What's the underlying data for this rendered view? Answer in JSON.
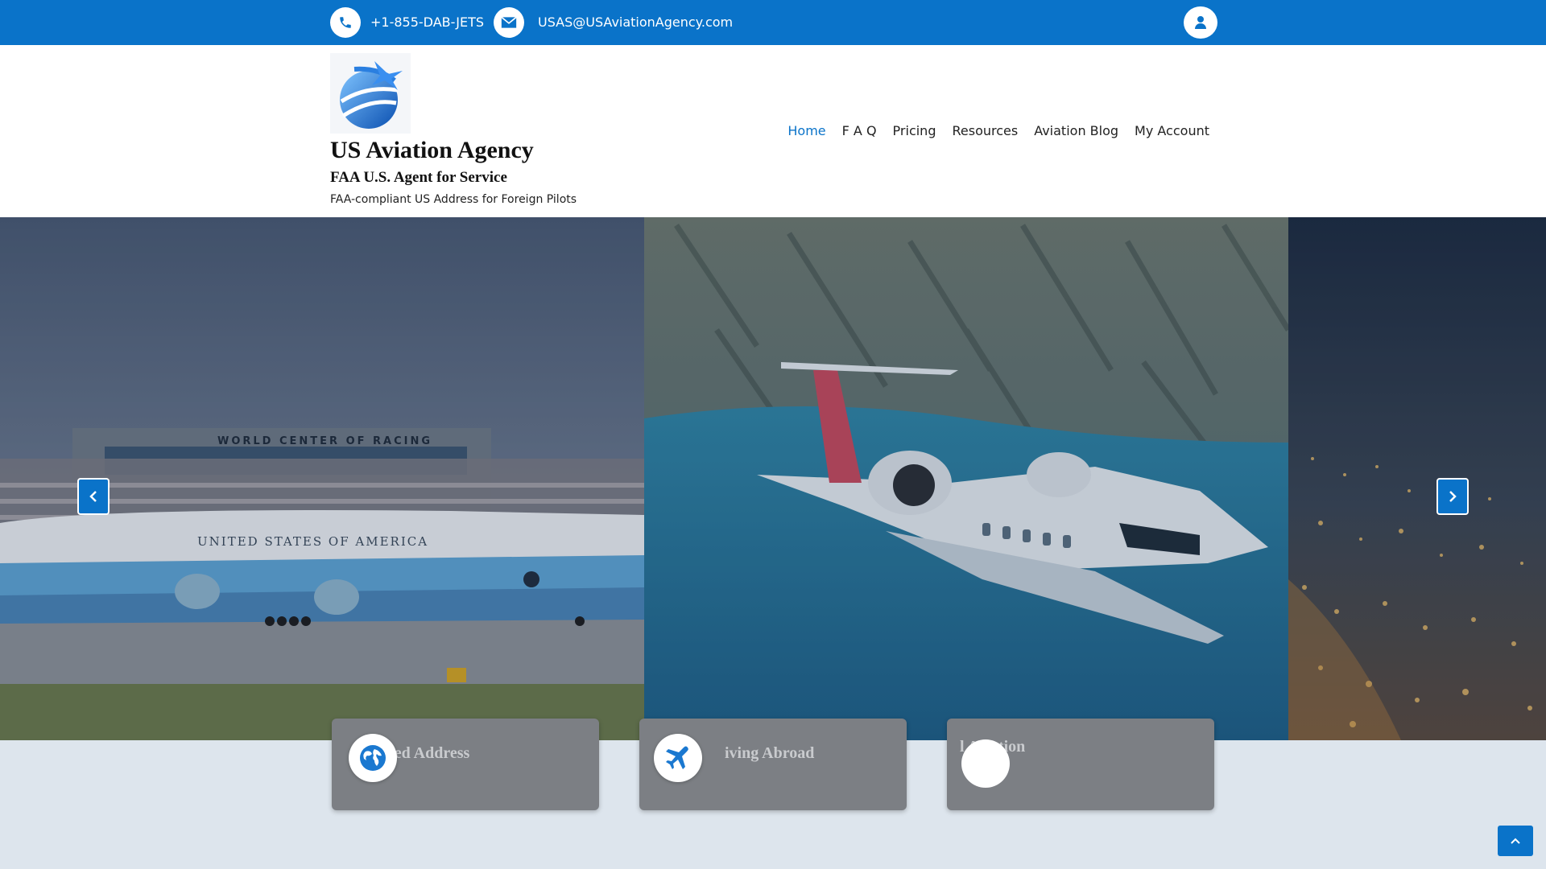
{
  "topbar": {
    "phone": "+1-855-DAB-JETS",
    "email": "USAS@USAviationAgency.com",
    "icons": [
      "phone-icon",
      "envelope-icon",
      "user-icon"
    ]
  },
  "header": {
    "site_title": "US Aviation Agency",
    "subtitle": "FAA U.S. Agent for Service",
    "tagline": "FAA-compliant US Address for Foreign Pilots",
    "logo": "globe-plane-logo"
  },
  "nav": {
    "items": [
      {
        "label": "Home",
        "active": true
      },
      {
        "label": "F A Q",
        "active": false
      },
      {
        "label": "Pricing",
        "active": false
      },
      {
        "label": "Resources",
        "active": false
      },
      {
        "label": "Aviation Blog",
        "active": false
      },
      {
        "label": "My Account",
        "active": false
      }
    ]
  },
  "hero": {
    "slide1_text": "WORLD CENTER OF RACING",
    "slide1_plane_text": "UNITED STATES OF AMERICA",
    "prev_icon": "chevron-left-icon",
    "next_icon": "chevron-right-icon"
  },
  "cards": [
    {
      "title": "US-Based Address",
      "visible_title": "ased Address",
      "icon": "globe-icon"
    },
    {
      "title": "Living Abroad",
      "visible_title": "iving Abroad",
      "icon": "airplane-icon"
    },
    {
      "title": "Aviation",
      "visible_title": "l Aviation",
      "icon": "blank-icon"
    }
  ],
  "colors": {
    "accent": "#0a73c9",
    "card_bg": "#7c7f84",
    "page_bg": "#dde5ed"
  },
  "back_to_top_icon": "chevron-up-icon"
}
